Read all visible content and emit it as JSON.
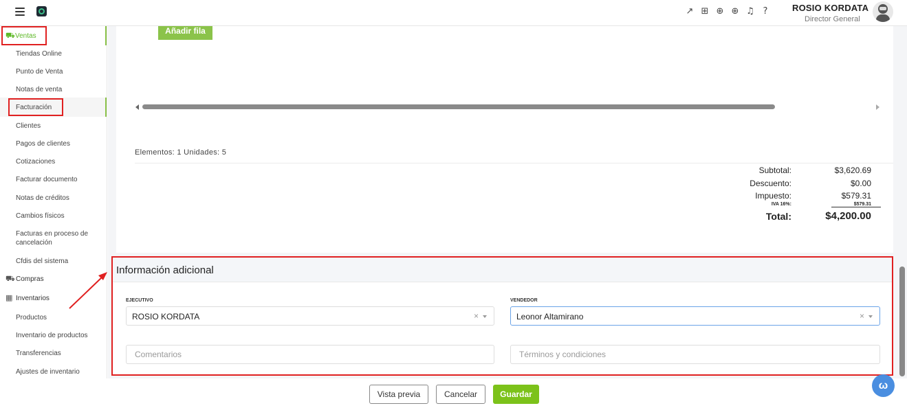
{
  "topbar": {
    "user_name": "ROSIO KORDATA",
    "user_role": "Director General",
    "icons": [
      "external-link-icon",
      "gift-icon",
      "zoom-icon",
      "add-circle-icon",
      "bell-icon",
      "help-icon"
    ]
  },
  "sidebar": {
    "ventas_label": "Ventas",
    "items": [
      "Tiendas Online",
      "Punto de Venta",
      "Notas de venta",
      "Facturación",
      "Clientes",
      "Pagos de clientes",
      "Cotizaciones",
      "Facturar documento",
      "Notas de créditos",
      "Cambios físicos",
      "Facturas en proceso de",
      "cancelación",
      "Cfdis del sistema"
    ],
    "compras_label": "Compras",
    "inventarios_label": "Inventarios",
    "inv_items": [
      "Productos",
      "Inventario de productos",
      "Transferencias",
      "Ajustes de inventario"
    ]
  },
  "main": {
    "add_row_label": "Añadir fila",
    "elements_text": "Elementos:  1   Unidades:  5",
    "totals": {
      "subtotal_label": "Subtotal:",
      "subtotal_value": "$3,620.69",
      "descuento_label": "Descuento:",
      "descuento_value": "$0.00",
      "impuesto_label": "Impuesto:",
      "impuesto_value": "$579.31",
      "iva_label": "IVA 16%:",
      "iva_value": "$579.31",
      "total_label": "Total:",
      "total_value": "$4,200.00"
    }
  },
  "info": {
    "title": "Información adicional",
    "ejecutivo_label": "EJECUTIVO",
    "ejecutivo_value": "ROSIO KORDATA",
    "vendedor_label": "VENDEDOR",
    "vendedor_value": "Leonor Altamirano",
    "comentarios_placeholder": "Comentarios",
    "terminos_placeholder": "Términos y condiciones",
    "clear_glyph": "×"
  },
  "footer": {
    "preview_label": "Vista previa",
    "cancel_label": "Cancelar",
    "save_label": "Guardar"
  },
  "colors": {
    "accent_green": "#8bc34a",
    "highlight_red": "#e02020",
    "chat_blue": "#4a8ee0"
  }
}
